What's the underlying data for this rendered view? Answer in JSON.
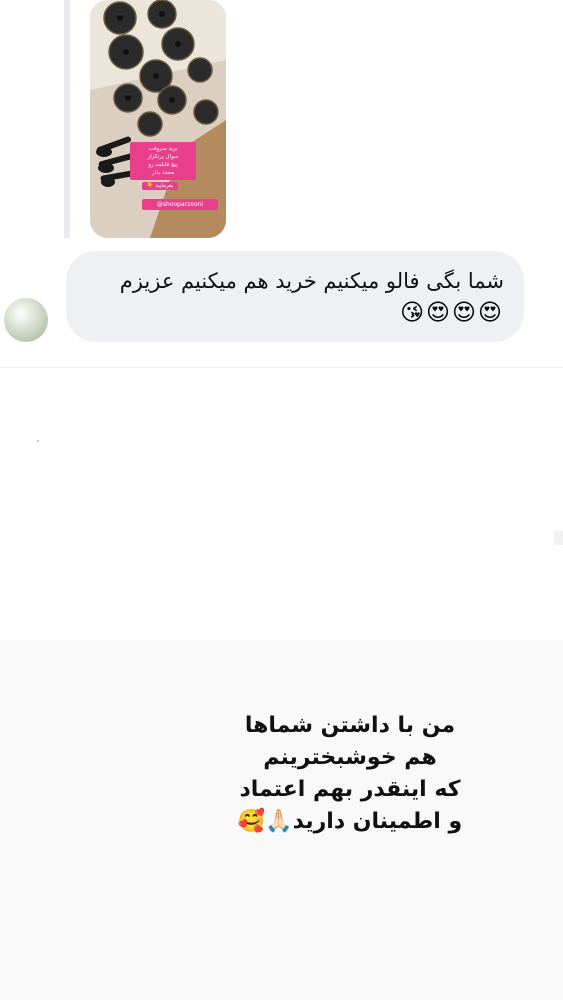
{
  "story": {
    "caption_lines": [
      "برید سروقت",
      "سوال پرتکرار",
      "پیج قابلمه رو",
      "مجدد بذار"
    ],
    "cta": "بفرمایید 👇",
    "handle": "@shooparzooni"
  },
  "message": {
    "text": "شما بگی فالو میکنیم خرید هم میکنیم عزیزم",
    "emoji": "😍😍😍😘"
  },
  "caption_block": {
    "lines": [
      "من با داشتن شماها",
      "هم خوشبخترینم",
      "که اینقدر بهم اعتماد",
      "و اطمینان دارید🙏🏻🥰"
    ]
  }
}
